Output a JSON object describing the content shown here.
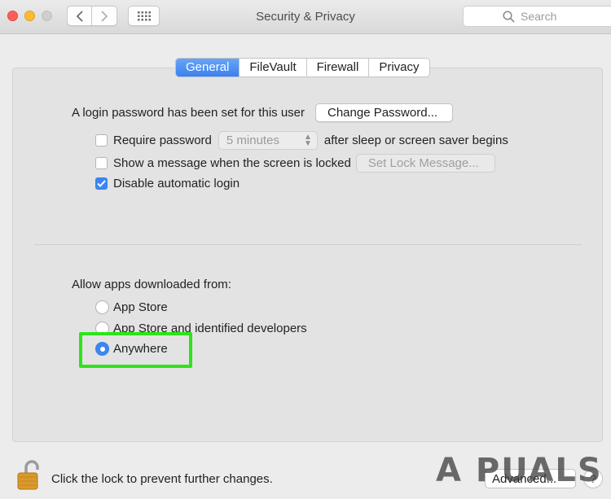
{
  "window": {
    "title": "Security & Privacy"
  },
  "search": {
    "placeholder": "Search"
  },
  "tabs": [
    {
      "label": "General",
      "active": true
    },
    {
      "label": "FileVault",
      "active": false
    },
    {
      "label": "Firewall",
      "active": false
    },
    {
      "label": "Privacy",
      "active": false
    }
  ],
  "general": {
    "login_password_text": "A login password has been set for this user",
    "change_password_label": "Change Password...",
    "require_password": {
      "label": "Require password",
      "checked": false,
      "delay_value": "5 minutes",
      "suffix": "after sleep or screen saver begins"
    },
    "show_message": {
      "label": "Show a message when the screen is locked",
      "checked": false,
      "button_label": "Set Lock Message..."
    },
    "disable_auto_login": {
      "label": "Disable automatic login",
      "checked": true
    },
    "allow_apps": {
      "heading": "Allow apps downloaded from:",
      "options": [
        {
          "label": "App Store",
          "selected": false
        },
        {
          "label": "App Store and identified developers",
          "selected": false
        },
        {
          "label": "Anywhere",
          "selected": true
        }
      ]
    }
  },
  "footer": {
    "lock_text": "Click the lock to prevent further changes.",
    "advanced_label": "Advanced...",
    "help_label": "?"
  },
  "watermark": {
    "text": "A  PUALS"
  },
  "colors": {
    "accent": "#3c86f4",
    "highlight": "#2ee31a",
    "close": "#fc5f57",
    "minimize": "#fdbc2f"
  }
}
